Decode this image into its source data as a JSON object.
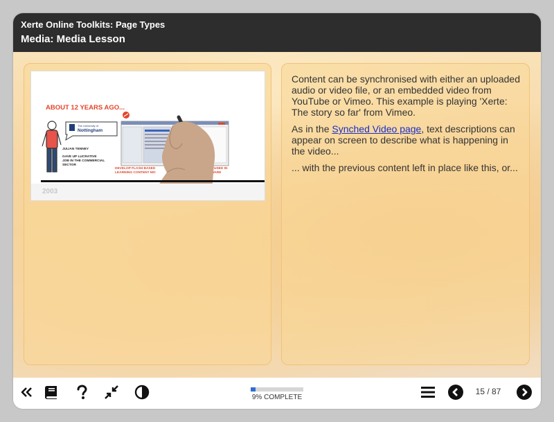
{
  "header": {
    "project_title": "Xerte Online Toolkits: Page Types",
    "page_title": "Media: Media Lesson"
  },
  "video": {
    "heading": "ABOUT 12 YEARS AGO...",
    "university_name": "Nottingham",
    "university_prefix": "The University of",
    "person_name": "JULIAN TENNEY",
    "person_caption_1": "GAVE UP LUCRATIVE",
    "person_caption_2": "JOB IN THE COMMERCIAL",
    "person_caption_3": "SECTOR",
    "flash_caption_1": "DEVELOP FLASH BASED",
    "flash_caption_2": "LEARNING CONTENT MO",
    "right_caption_1": "USED IN",
    "right_caption_2": "WARE",
    "year": "2003"
  },
  "content": {
    "paragraph_1": "Content can be synchronised with either an uploaded audio or video file, or an embedded video from YouTube or Vimeo. This example is playing 'Xerte: The story so far' from Vimeo.",
    "paragraph_2_before": "As in the ",
    "paragraph_2_link": "Synched Video page",
    "paragraph_2_after": ", text descriptions can appear on screen to describe what is happening in the video...",
    "paragraph_3": "... with the previous content left in place like this, or..."
  },
  "footer": {
    "progress_label": "9% COMPLETE",
    "progress_fraction": 0.09,
    "page_counter": "15 / 87"
  },
  "icons": {
    "back": "double-chevron-left-icon",
    "glossary": "book-icon",
    "help": "question-icon",
    "fullscreen": "compress-arrows-icon",
    "contrast": "contrast-icon",
    "menu": "hamburger-menu-icon",
    "previous": "previous-arrow-icon",
    "next": "next-arrow-icon"
  },
  "colors": {
    "header_bg": "#2d2d2d",
    "accent_red": "#e2452a",
    "progress_fill": "#2f6dd1",
    "link": "#1a2fc8"
  }
}
